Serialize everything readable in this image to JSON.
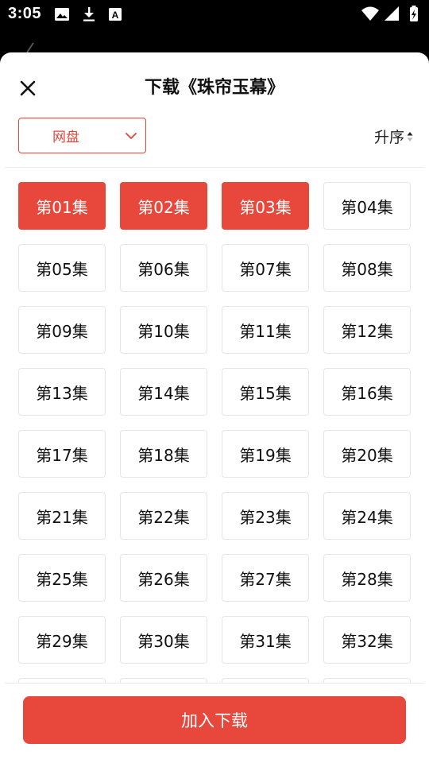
{
  "status_bar": {
    "time": "3:05",
    "left_icons": [
      "image-icon",
      "download-icon",
      "text-a-icon"
    ],
    "right_icons": [
      "wifi-icon",
      "cellular-icon",
      "battery-charging-icon"
    ]
  },
  "sheet": {
    "title": "下载《珠帘玉幕》",
    "close_icon": "close-icon",
    "source_select": {
      "selected": "网盘"
    },
    "sort_label": "升序",
    "episodes": [
      {
        "label": "第01集",
        "selected": true
      },
      {
        "label": "第02集",
        "selected": true
      },
      {
        "label": "第03集",
        "selected": true
      },
      {
        "label": "第04集",
        "selected": false
      },
      {
        "label": "第05集",
        "selected": false
      },
      {
        "label": "第06集",
        "selected": false
      },
      {
        "label": "第07集",
        "selected": false
      },
      {
        "label": "第08集",
        "selected": false
      },
      {
        "label": "第09集",
        "selected": false
      },
      {
        "label": "第10集",
        "selected": false
      },
      {
        "label": "第11集",
        "selected": false
      },
      {
        "label": "第12集",
        "selected": false
      },
      {
        "label": "第13集",
        "selected": false
      },
      {
        "label": "第14集",
        "selected": false
      },
      {
        "label": "第15集",
        "selected": false
      },
      {
        "label": "第16集",
        "selected": false
      },
      {
        "label": "第17集",
        "selected": false
      },
      {
        "label": "第18集",
        "selected": false
      },
      {
        "label": "第19集",
        "selected": false
      },
      {
        "label": "第20集",
        "selected": false
      },
      {
        "label": "第21集",
        "selected": false
      },
      {
        "label": "第22集",
        "selected": false
      },
      {
        "label": "第23集",
        "selected": false
      },
      {
        "label": "第24集",
        "selected": false
      },
      {
        "label": "第25集",
        "selected": false
      },
      {
        "label": "第26集",
        "selected": false
      },
      {
        "label": "第27集",
        "selected": false
      },
      {
        "label": "第28集",
        "selected": false
      },
      {
        "label": "第29集",
        "selected": false
      },
      {
        "label": "第30集",
        "selected": false
      },
      {
        "label": "第31集",
        "selected": false
      },
      {
        "label": "第32集",
        "selected": false
      },
      {
        "label": "",
        "selected": false
      },
      {
        "label": "",
        "selected": false
      },
      {
        "label": "",
        "selected": false
      },
      {
        "label": "",
        "selected": false
      }
    ],
    "add_button_label": "加入下载"
  },
  "colors": {
    "accent": "#e8473b",
    "border": "#e6e6e6",
    "text": "#111111"
  }
}
